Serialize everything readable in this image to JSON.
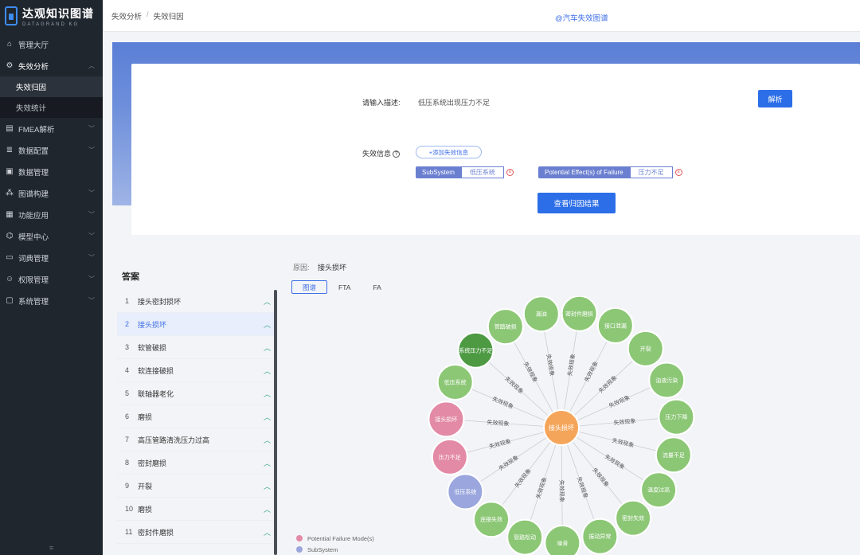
{
  "app": {
    "name": "达观知识图谱",
    "subtitle": "DATAGRAND KG"
  },
  "sidebar": {
    "items": [
      {
        "label": "管理大厅",
        "icon": "home-icon"
      },
      {
        "label": "失效分析",
        "icon": "gear-icon",
        "open": true,
        "children": [
          {
            "label": "失效归因",
            "active": true
          },
          {
            "label": "失效统计"
          }
        ]
      },
      {
        "label": "FMEA解析",
        "icon": "book-icon"
      },
      {
        "label": "数据配置",
        "icon": "database-icon"
      },
      {
        "label": "数据管理",
        "icon": "document-icon"
      },
      {
        "label": "图谱构建",
        "icon": "graph-icon"
      },
      {
        "label": "功能应用",
        "icon": "grid-icon"
      },
      {
        "label": "模型中心",
        "icon": "model-icon"
      },
      {
        "label": "词典管理",
        "icon": "dictionary-icon"
      },
      {
        "label": "权限管理",
        "icon": "user-icon"
      },
      {
        "label": "系统管理",
        "icon": "settings-icon"
      }
    ],
    "footer": "≡"
  },
  "header": {
    "breadcrumb": [
      "失效分析",
      "失效归因"
    ],
    "title": "@汽车失效图谱"
  },
  "form": {
    "desc_label": "请输入描述:",
    "desc_value": "低压系统出现压力不足",
    "analyze_label": "解析",
    "info_label": "失效信息",
    "add_label": "+添加失效信息",
    "tags": [
      {
        "name": "SubSystem",
        "value": "低压系统"
      },
      {
        "name": "Potential Effect(s) of Failure",
        "value": "压力不足"
      }
    ],
    "view_label": "查看归因结果"
  },
  "answer": {
    "title": "答案",
    "items": [
      {
        "num": "1",
        "label": "接头密封损坏"
      },
      {
        "num": "2",
        "label": "接头损坏",
        "active": true
      },
      {
        "num": "3",
        "label": "软管破损"
      },
      {
        "num": "4",
        "label": "软连接破损"
      },
      {
        "num": "5",
        "label": "联轴器老化"
      },
      {
        "num": "6",
        "label": "磨损"
      },
      {
        "num": "7",
        "label": "高压管路清洗压力过高"
      },
      {
        "num": "8",
        "label": "密封磨损"
      },
      {
        "num": "9",
        "label": "开裂"
      },
      {
        "num": "10",
        "label": "磨损"
      },
      {
        "num": "11",
        "label": "密封件磨损"
      }
    ]
  },
  "graph": {
    "cause_label": "原因:",
    "cause_value": "接头损坏",
    "tabs": [
      "图谱",
      "FTA",
      "FA"
    ],
    "active_tab": 0,
    "center_label": "接头损坏",
    "edge_label": "失效现象",
    "colors": {
      "center": "#f5a55a",
      "green": "#8cc776",
      "dark_green": "#4d9a43",
      "pink": "#e38aa6",
      "blue": "#9aa6dd",
      "edge": "#c9cdd4"
    },
    "nodes": [
      {
        "label": "漏油",
        "color": "green"
      },
      {
        "label": "密封件磨损",
        "color": "green"
      },
      {
        "label": "接口泄漏",
        "color": "green"
      },
      {
        "label": "开裂",
        "color": "green"
      },
      {
        "label": "油液污染",
        "color": "green"
      },
      {
        "label": "压力下降",
        "color": "green"
      },
      {
        "label": "流量不足",
        "color": "green"
      },
      {
        "label": "温度过高",
        "color": "green"
      },
      {
        "label": "密封失效",
        "color": "green"
      },
      {
        "label": "振动异常",
        "color": "green"
      },
      {
        "label": "噪音",
        "color": "green"
      },
      {
        "label": "管路松动",
        "color": "green"
      },
      {
        "label": "连接失效",
        "color": "green"
      },
      {
        "label": "低压系统",
        "color": "blue"
      },
      {
        "label": "压力不足",
        "color": "pink"
      },
      {
        "label": "接头损坏",
        "color": "pink"
      },
      {
        "label": "低压系统",
        "color": "green"
      },
      {
        "label": "系统压力不足",
        "color": "dark_green"
      },
      {
        "label": "管路破损",
        "color": "green"
      }
    ]
  },
  "legend": [
    {
      "label": "Potential Failure Mode(s)",
      "color": "pink"
    },
    {
      "label": "SubSystem",
      "color": "blue"
    }
  ]
}
